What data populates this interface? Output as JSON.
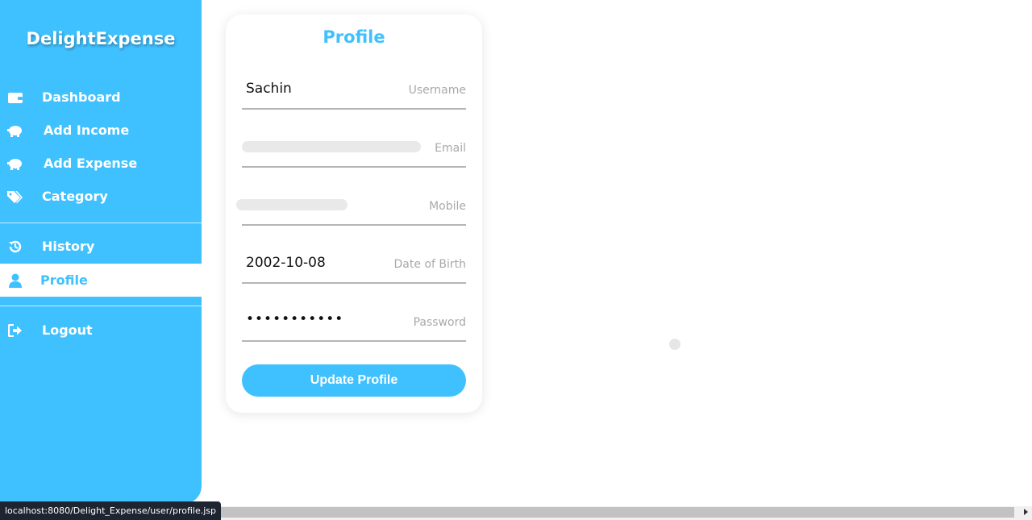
{
  "brand": "DelightExpense",
  "nav": {
    "dashboard": "Dashboard",
    "add_income": "Add Income",
    "add_expense": "Add Expense",
    "category": "Category",
    "history": "History",
    "profile": "Profile",
    "logout": "Logout"
  },
  "profile_card": {
    "title": "Profile",
    "fields": {
      "username": {
        "value": "Sachin",
        "label": "Username"
      },
      "email": {
        "value": "",
        "label": "Email"
      },
      "mobile": {
        "value": "",
        "label": "Mobile"
      },
      "dob": {
        "value": "2002-10-08",
        "label": "Date of Birth"
      },
      "password": {
        "value": "•••••••••••",
        "label": "Password"
      }
    },
    "button": "Update Profile"
  },
  "status_url": "localhost:8080/Delight_Expense/user/profile.jsp",
  "colors": {
    "accent": "#40c1ff",
    "white": "#ffffff"
  }
}
